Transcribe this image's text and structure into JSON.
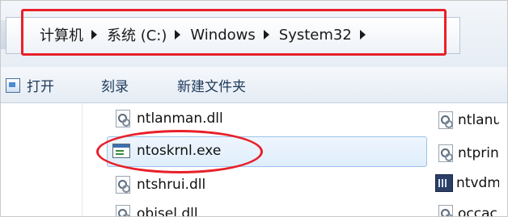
{
  "breadcrumb": {
    "items": [
      {
        "label": "计算机"
      },
      {
        "label": "系统 (C:)"
      },
      {
        "label": "Windows"
      },
      {
        "label": "System32"
      }
    ]
  },
  "toolbar": {
    "open_label": "打开",
    "burn_label": "刻录",
    "new_folder_label": "新建文件夹"
  },
  "files": {
    "col1": [
      {
        "label": "ntlanman.dll",
        "icon": "dll-file-icon"
      },
      {
        "label": "ntoskrnl.exe",
        "icon": "exe-file-icon",
        "selected": true
      },
      {
        "label": "ntshrui.dll",
        "icon": "dll-file-icon"
      },
      {
        "label": "objsel.dll",
        "icon": "dll-file-icon"
      }
    ],
    "col2": [
      {
        "label": "ntlanu",
        "icon": "dll-file-icon"
      },
      {
        "label": "ntprin",
        "icon": "dll-file-icon"
      },
      {
        "label": "ntvdm",
        "icon": "application-icon"
      },
      {
        "label": "occac",
        "icon": "dll-file-icon"
      }
    ]
  },
  "colors": {
    "annotation": "#e8202a",
    "selection": "#dfeefc"
  }
}
